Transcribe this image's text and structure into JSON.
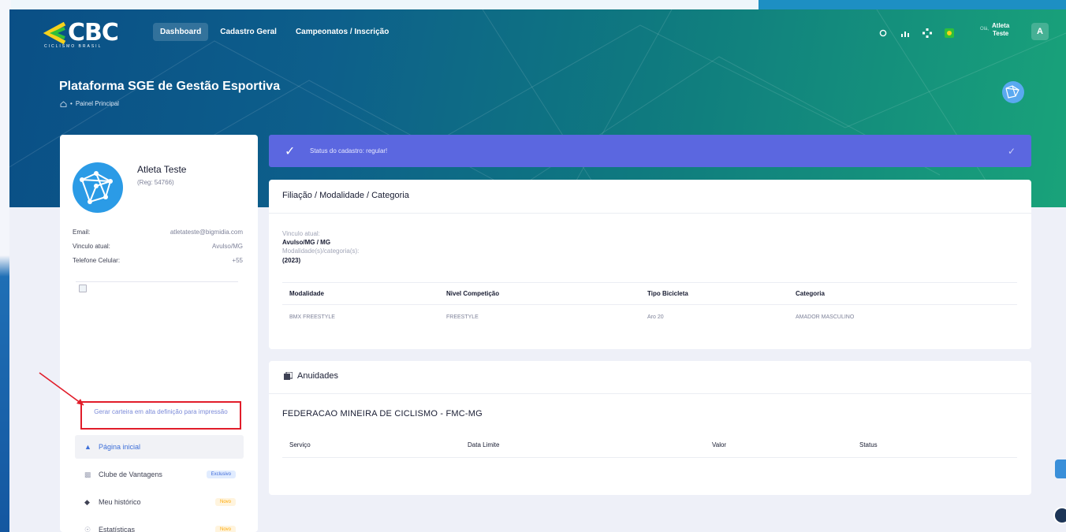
{
  "brand": {
    "logo_text": "CBC",
    "logo_sub": "CICLISMO BRASIL"
  },
  "nav": {
    "items": [
      {
        "label": "Dashboard",
        "active": true
      },
      {
        "label": "Cadastro Geral",
        "active": false
      },
      {
        "label": "Campeonatos / Inscrição",
        "active": false
      }
    ]
  },
  "user": {
    "greeting": "Olá,",
    "first": "Atleta",
    "last": "Teste",
    "initial": "A"
  },
  "page": {
    "title": "Plataforma SGE de Gestão Esportiva",
    "breadcrumb": "Painel Principal"
  },
  "profile": {
    "name": "Atleta Teste",
    "reg": "(Reg: 54766)",
    "email_label": "Email:",
    "email": "atletateste@bigmidia.com",
    "vinculo_label": "Vinculo atual:",
    "vinculo": "Avulso/MG",
    "telefone_label": "Telefone Celular:",
    "telefone": "+55",
    "print_link": "Gerar carteira em alta definição para impressão"
  },
  "menu": [
    {
      "label": "Página inicial",
      "icon": "user-icon",
      "active": true,
      "badge": ""
    },
    {
      "label": "Clube de Vantagens",
      "icon": "shield-icon",
      "active": false,
      "badge": "Exclusivo",
      "badge_color": "blue"
    },
    {
      "label": "Meu histórico",
      "icon": "diamond-icon",
      "active": false,
      "badge": "Novo",
      "badge_color": "orange"
    },
    {
      "label": "Estatísticas",
      "icon": "stats-icon",
      "active": false,
      "badge": "Novo",
      "badge_color": "orange"
    }
  ],
  "status": {
    "text": "Status do cadastro: regular!"
  },
  "filiacao": {
    "title": "Filiação / Modalidade / Categoria",
    "vinculo_label": "Vinculo atual:",
    "vinculo_value": "Avulso/MG / MG",
    "modalidade_label": "Modalidade(s)/categoria(s):",
    "year": "(2023)",
    "headers": [
      "Modalidade",
      "Nivel Competição",
      "Tipo Bicicleta",
      "Categoria"
    ],
    "rows": [
      [
        "BMX FREESTYLE",
        "FREESTYLE",
        "Aro 20",
        "AMADOR MASCULINO"
      ]
    ]
  },
  "anuidades": {
    "title": "Anuidades",
    "federation": "FEDERACAO MINEIRA DE CICLISMO - FMC-MG",
    "headers": [
      "Serviço",
      "Data Limite",
      "Valor",
      "Status"
    ]
  },
  "colors": {
    "accent": "#5b67e0",
    "header_start": "#0a4f86",
    "header_end": "#19a37a",
    "annotation": "#e11d2a"
  }
}
